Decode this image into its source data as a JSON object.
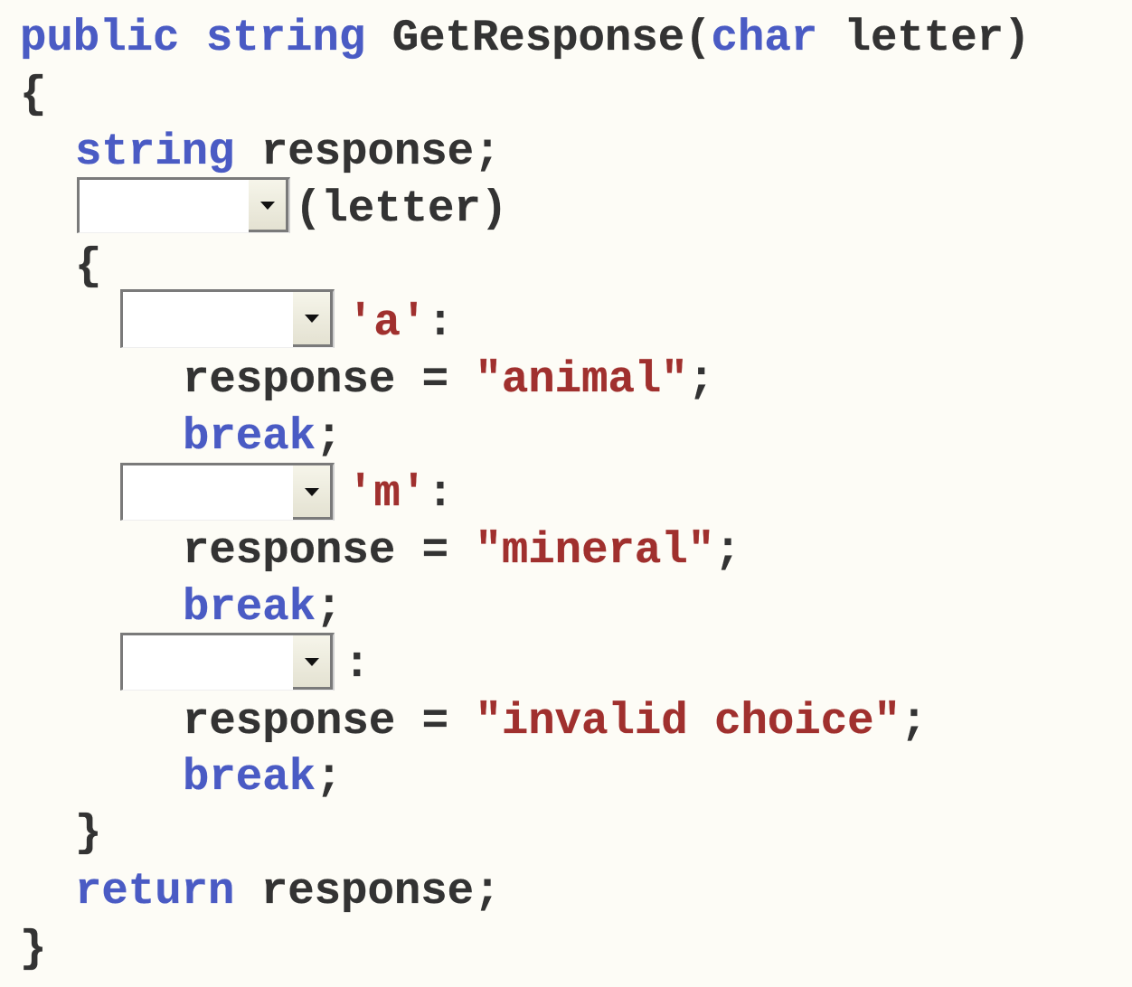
{
  "code": {
    "l1": {
      "kw1": "public",
      "kw2": "string",
      "name": "GetResponse(",
      "kw3": "char",
      "rest": " letter)"
    },
    "open_brace": "{",
    "l3": {
      "kw": "string",
      "rest": " response;"
    },
    "switch_suffix": "(letter)",
    "inner_open": "{",
    "case_a": {
      "literal": "'a'",
      "colon": ":"
    },
    "assign_a": {
      "lhs": "response = ",
      "str": "\"animal\"",
      "end": ";"
    },
    "break_kw": "break",
    "semicolon": ";",
    "case_m": {
      "literal": "'m'",
      "colon": ":"
    },
    "assign_m": {
      "lhs": "response = ",
      "str": "\"mineral\"",
      "end": ";"
    },
    "default_colon": ":",
    "assign_d": {
      "lhs": "response = ",
      "str": "\"invalid choice\"",
      "end": ";"
    },
    "inner_close": "}",
    "ret": {
      "kw": "return",
      "rest": " response;"
    },
    "close_brace": "}"
  },
  "dropdowns": [
    {
      "id": "switch-keyword",
      "value": ""
    },
    {
      "id": "case-a-keyword",
      "value": ""
    },
    {
      "id": "case-m-keyword",
      "value": ""
    },
    {
      "id": "default-keyword",
      "value": ""
    }
  ],
  "colors": {
    "keyword": "#4a5bc4",
    "string": "#a0302e",
    "text": "#333333",
    "background": "#fdfcf6"
  }
}
